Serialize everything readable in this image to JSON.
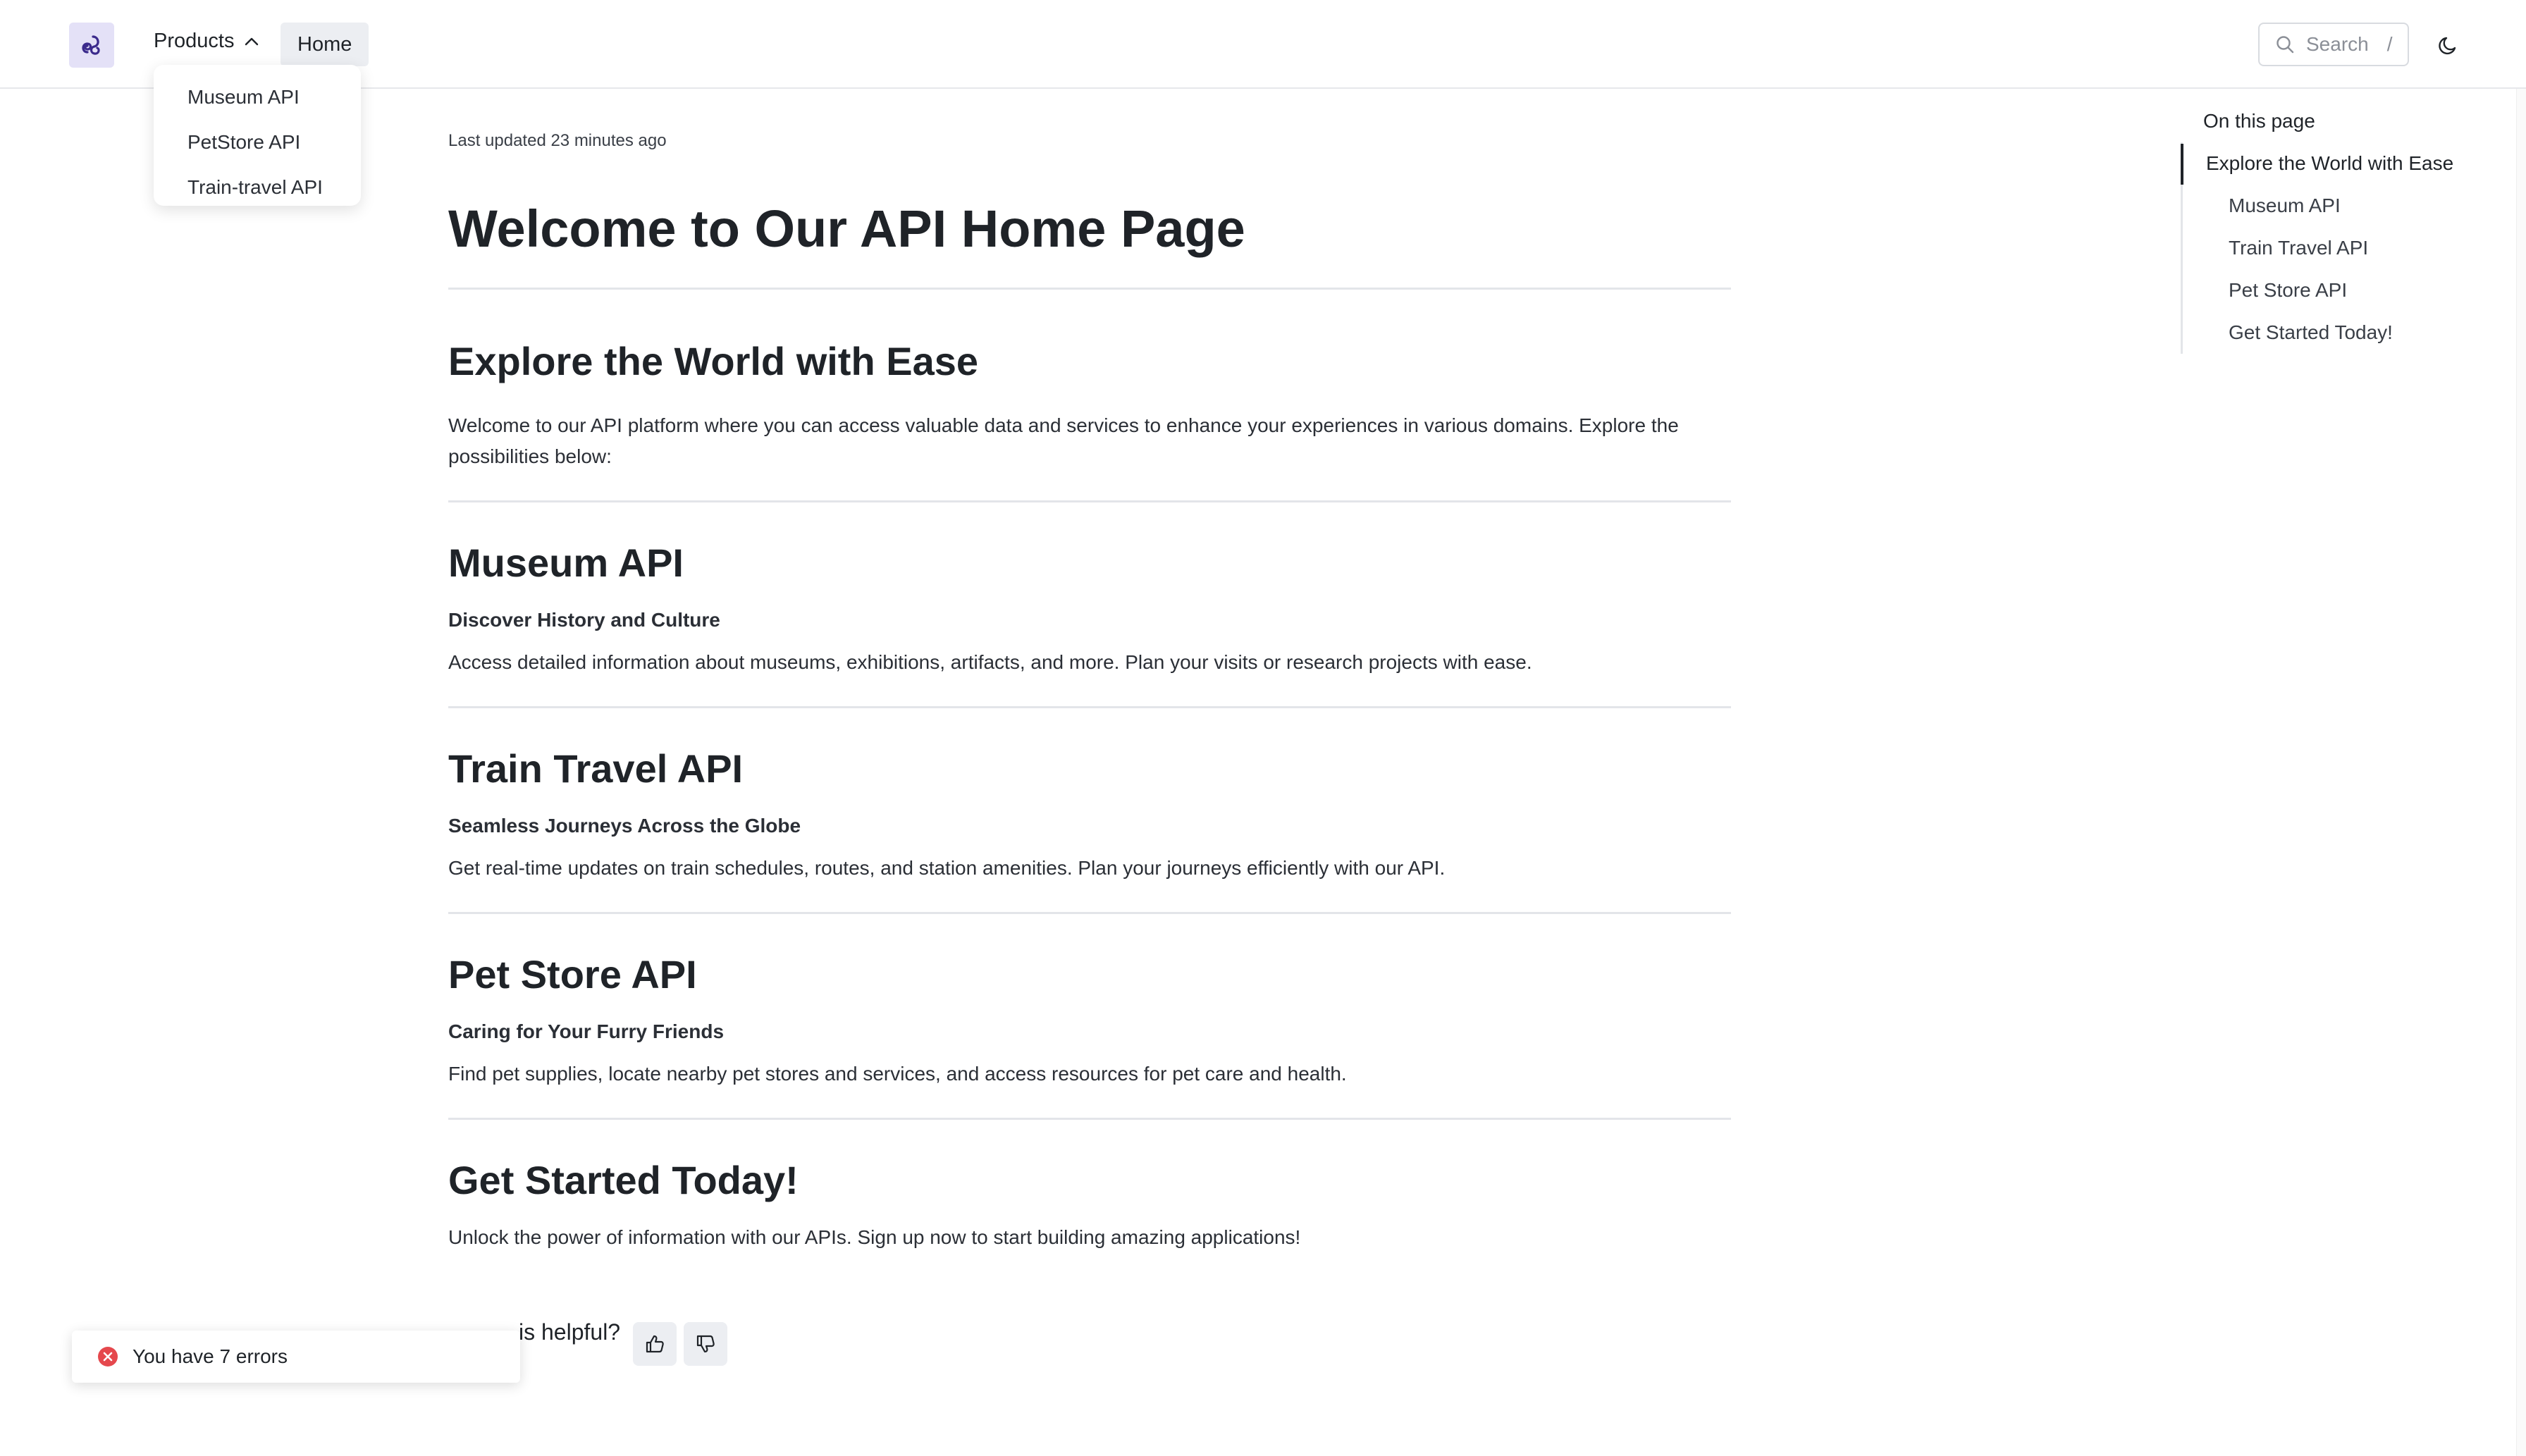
{
  "header": {
    "products_label": "Products",
    "home_label": "Home",
    "search_placeholder": "Search",
    "search_shortcut": "/"
  },
  "products_menu": [
    "Museum API",
    "PetStore API",
    "Train-travel API"
  ],
  "page": {
    "last_updated": "Last updated 23 minutes ago",
    "title": "Welcome to Our API Home Page",
    "intro_heading": "Explore the World with Ease",
    "intro_text": "Welcome to our API platform where you can access valuable data and services to enhance your experiences in various domains. Explore the possibilities below:",
    "sections": [
      {
        "heading": "Museum API",
        "subheading": "Discover History and Culture",
        "text": "Access detailed information about museums, exhibitions, artifacts, and more. Plan your visits or research projects with ease."
      },
      {
        "heading": "Train Travel API",
        "subheading": "Seamless Journeys Across the Globe",
        "text": "Get real-time updates on train schedules, routes, and station amenities. Plan your journeys efficiently with our API."
      },
      {
        "heading": "Pet Store API",
        "subheading": "Caring for Your Furry Friends",
        "text": "Find pet supplies, locate nearby pet stores and services, and access resources for pet care and health."
      }
    ],
    "cta_heading": "Get Started Today!",
    "cta_text": "Unlock the power of information with our APIs. Sign up now to start building amazing applications!",
    "helpful_question": "is helpful?"
  },
  "toc": {
    "title": "On this page",
    "items": [
      "Explore the World with Ease",
      "Museum API",
      "Train Travel API",
      "Pet Store API",
      "Get Started Today!"
    ],
    "active_index": 0
  },
  "toast": {
    "message": "You have 7 errors",
    "color": "#e5484d"
  },
  "colors": {
    "logo_bg": "#e4e1f7",
    "logo_fg": "#3b2a8c"
  },
  "icons": {
    "logo": "redocly-logo-icon",
    "products_chevron": "chevron-up-icon",
    "search": "search-icon",
    "theme": "moon-icon",
    "thumbs_up": "thumbs-up-icon",
    "thumbs_down": "thumbs-down-icon",
    "error": "error-circle-icon"
  }
}
